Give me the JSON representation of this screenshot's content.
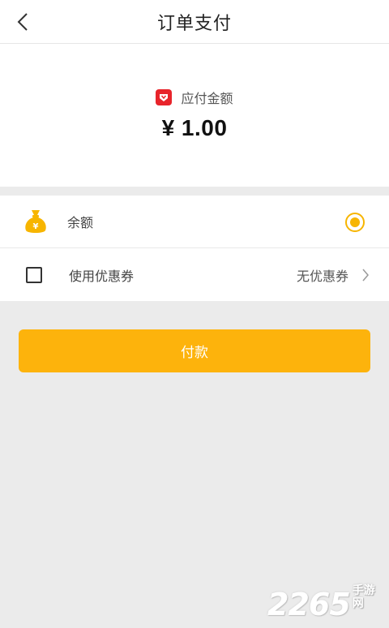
{
  "header": {
    "title": "订单支付"
  },
  "amount": {
    "label": "应付金额",
    "value": "¥ 1.00"
  },
  "options": {
    "balance_label": "余额",
    "balance_selected": true,
    "coupon_label": "使用优惠券",
    "coupon_checked": false,
    "coupon_value": "无优惠券"
  },
  "pay_button": {
    "label": "付款"
  },
  "watermark": {
    "number": "2265",
    "text": "手游网"
  },
  "colors": {
    "accent": "#fdb30c",
    "amount_icon": "#e8242b",
    "background": "#ebebeb"
  }
}
